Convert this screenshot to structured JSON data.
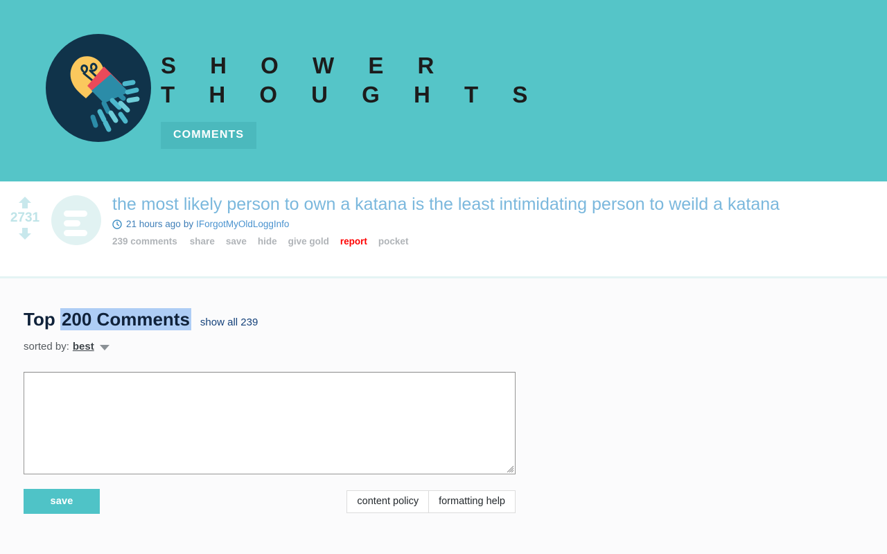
{
  "header": {
    "logo_icon": "shower-lightbulb-logo",
    "site_title": "S H O W E R\nT H O U G H T S",
    "tabs": [
      {
        "label": "COMMENTS",
        "active": true
      }
    ],
    "colors": {
      "background": "#55c5c8",
      "tab_active": "#4bb9bd",
      "title_text": "#1c1c1c"
    }
  },
  "post": {
    "score": "2731",
    "upvote_icon": "arrow-up-icon",
    "downvote_icon": "arrow-down-icon",
    "thumbnail_icon": "text-post-icon",
    "title": "the most likely person to own a katana is the least intimidating person to weild a katana",
    "clock_icon": "clock-icon",
    "time_ago": "21 hours ago",
    "by_label": "by",
    "author": "IForgotMyOldLoggInfo",
    "actions": [
      {
        "label": "239 comments",
        "style": "muted"
      },
      {
        "label": "share",
        "style": "muted"
      },
      {
        "label": "save",
        "style": "muted"
      },
      {
        "label": "hide",
        "style": "muted"
      },
      {
        "label": "give gold",
        "style": "muted"
      },
      {
        "label": "report",
        "style": "danger"
      },
      {
        "label": "pocket",
        "style": "muted"
      }
    ],
    "colors": {
      "title": "#7bb8dd",
      "score": "#bfe4e8",
      "action": "#b0b4b8",
      "report": "#ff0000"
    }
  },
  "comments": {
    "heading_prefix": "Top ",
    "heading_selected": "200 Comments",
    "show_all_link": "show all 239",
    "sorted_by_label": "sorted by:",
    "sorted_by_value": "best",
    "caret_icon": "chevron-down-icon",
    "selection_color": "#aecdf5"
  },
  "reply_form": {
    "textarea_value": "",
    "textarea_placeholder": "",
    "resize_handle_icon": "resize-grip-icon",
    "save_label": "save",
    "helper_buttons": [
      {
        "label": "content policy"
      },
      {
        "label": "formatting help"
      }
    ],
    "save_color": "#4fc3c7"
  }
}
